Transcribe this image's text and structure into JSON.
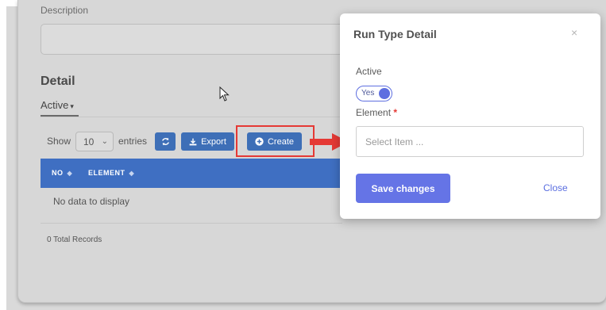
{
  "form": {
    "description_label": "Description",
    "detail_title": "Detail",
    "active_tab": "Active",
    "caret": "▾"
  },
  "table_controls": {
    "show_label": "Show",
    "entries_value": "10",
    "entries_label": "entries",
    "export_label": "Export",
    "create_label": "Create"
  },
  "table": {
    "columns": [
      "NO",
      "ELEMENT"
    ],
    "empty_text": "No data to display",
    "total_records": "0 Total Records"
  },
  "modal": {
    "title": "Run Type Detail",
    "close_glyph": "×",
    "active_label": "Active",
    "toggle_text": "Yes",
    "element_label": "Element",
    "required_mark": "*",
    "element_placeholder": "Select Item ...",
    "save_label": "Save changes",
    "close_label": "Close"
  },
  "colors": {
    "primary": "#3e6fb7",
    "modal_accent": "#6574e6",
    "highlight": "#e53935"
  }
}
